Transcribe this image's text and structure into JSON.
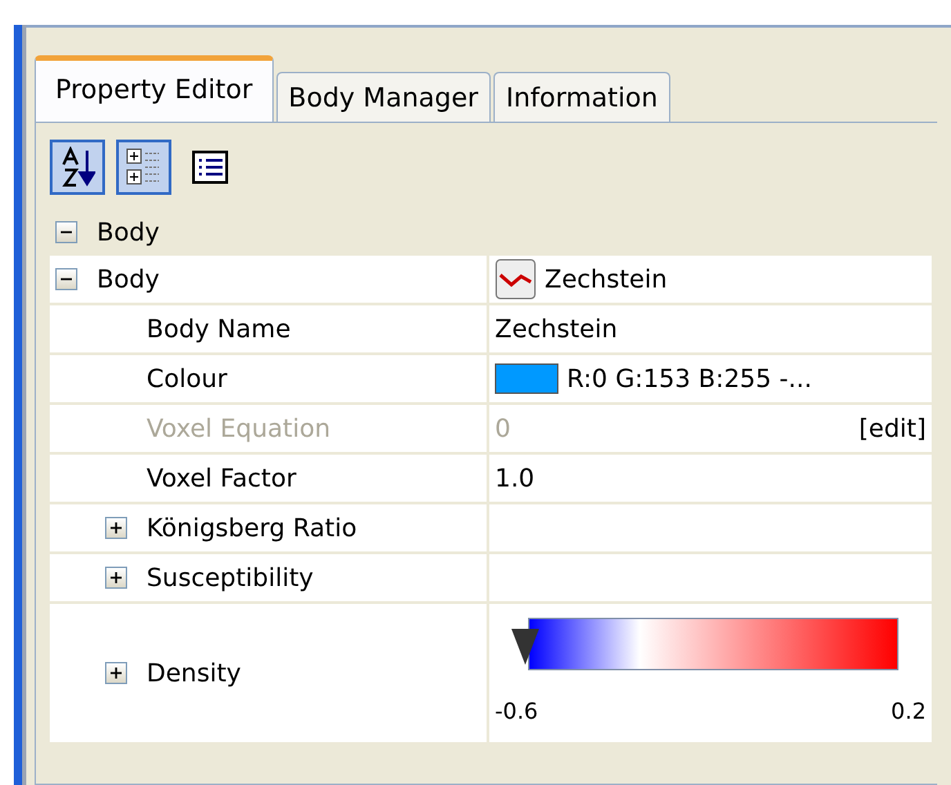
{
  "tabs": [
    {
      "label": "Property Editor",
      "selected": true
    },
    {
      "label": "Body Manager",
      "selected": false
    },
    {
      "label": "Information",
      "selected": false
    }
  ],
  "toolbar": [
    {
      "kind": "sort",
      "selected": true
    },
    {
      "kind": "categories",
      "selected": true
    },
    {
      "kind": "list",
      "selected": false
    }
  ],
  "section": {
    "label": "Body",
    "expanded": true,
    "rows": [
      {
        "kind": "object",
        "label": "Body",
        "value": "Zechstein",
        "expanded": true,
        "children": [
          {
            "kind": "text",
            "label": "Body Name",
            "value": "Zechstein",
            "disabled": false
          },
          {
            "kind": "colour",
            "label": "Colour",
            "value": "R:0 G:153 B:255 -...",
            "color": "#0099ff",
            "disabled": false
          },
          {
            "kind": "edit",
            "label": "Voxel Equation",
            "value": "0",
            "action": "[edit]",
            "disabled": true
          },
          {
            "kind": "text",
            "label": "Voxel Factor",
            "value": "1.0",
            "disabled": false
          },
          {
            "kind": "group",
            "label": "Königsberg Ratio",
            "expanded": false
          },
          {
            "kind": "group",
            "label": "Susceptibility",
            "expanded": false
          },
          {
            "kind": "scale",
            "label": "Density",
            "expanded": false,
            "level": 0,
            "min": "-0.6",
            "max": "0.2"
          }
        ]
      }
    ]
  }
}
